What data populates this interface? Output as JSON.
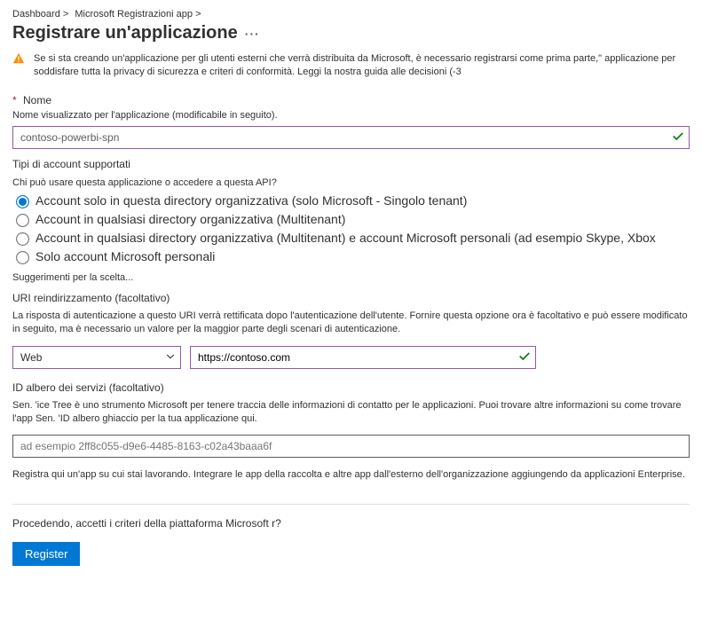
{
  "breadcrumb": {
    "item1": "Dashboard >",
    "item2": "Microsoft Registrazioni app >"
  },
  "title": "Registrare un'applicazione",
  "banner": "Se si sta creando un'applicazione per gli utenti esterni che verrà distribuita da Microsoft, è necessario registrarsi come prima parte,\" applicazione per soddisfare tutta la privacy di sicurezza e criteri di conformità. Leggi la nostra guida alle decisioni (-3",
  "name": {
    "required_mark": "*",
    "label": "Nome",
    "helper": "Nome visualizzato per l'applicazione (modificabile in seguito).",
    "value": "contoso-powerbi-spn"
  },
  "accounts": {
    "section": "Tipi di account supportati",
    "question": "Chi può usare questa applicazione o accedere a questa API?",
    "options": [
      "Account solo in questa directory organizzativa (solo Microsoft - Singolo tenant)",
      "Account in qualsiasi directory organizzativa (Multitenant)",
      "Account in qualsiasi directory organizzativa (Multitenant) e account Microsoft personali (ad esempio Skype, Xbox",
      "Solo account Microsoft personali"
    ],
    "help_link": "Suggerimenti per la scelta..."
  },
  "redirect": {
    "heading": "URI reindirizzamento (facoltativo)",
    "para": "La risposta di autenticazione a questo URI verrà rettificata dopo l'autenticazione dell'utente. Fornire questa opzione ora è facoltativo e può essere modificato in seguito, ma è necessario un valore per la maggior parte degli scenari di autenticazione.",
    "platform": "Web",
    "uri": "https://contoso.com"
  },
  "tree": {
    "heading": "ID albero dei servizi (facoltativo)",
    "para": "Sen. 'ice Tree è uno strumento Microsoft per tenere traccia delle informazioni di contatto per le applicazioni. Puoi trovare altre informazioni su come trovare l'app Sen. 'ID albero ghiaccio per la tua applicazione qui.",
    "placeholder": "ad esempio 2ff8c055-d9e6-4485-8163-c02a43baaa6f"
  },
  "enterprise_note": "Registra qui un'app su cui stai lavorando. Integrare le app della raccolta e altre app dall'esterno dell'organizzazione aggiungendo da applicazioni Enterprise.",
  "consent": "Procedendo, accetti i criteri della piattaforma Microsoft r?",
  "register_label": "Register"
}
